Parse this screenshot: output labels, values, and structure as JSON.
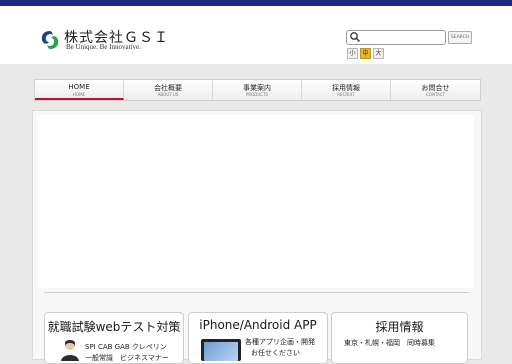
{
  "header": {
    "company_name": "株式会社ＧＳＩ",
    "tagline": "Be Unique. Be Innovative.",
    "search": {
      "placeholder": "",
      "button_label": "SEARCH"
    },
    "font_size": {
      "small": "小",
      "medium": "中",
      "large": "大",
      "selected": "中"
    }
  },
  "nav": [
    {
      "jp": "HOME",
      "en": "HOME"
    },
    {
      "jp": "会社概要",
      "en": "ABOUT US"
    },
    {
      "jp": "事業案内",
      "en": "PRODUCTS"
    },
    {
      "jp": "採用情報",
      "en": "RECRUIT"
    },
    {
      "jp": "お問合せ",
      "en": "CONTACT"
    }
  ],
  "cards": [
    {
      "title": "就職試験webテスト対策",
      "line1": "SPI CAB GAB クレペリン",
      "line2": "一般常識　ビジネスマナー"
    },
    {
      "title": "iPhone/Android APP",
      "line1": "各種アプリ企画・開発",
      "line2": "お任せください"
    },
    {
      "title": "採用情報",
      "line1": "東京・札幌・福岡　同時募集"
    }
  ],
  "colors": {
    "top_bar": "#1c2a86",
    "nav_active_underline": "#c20f2d",
    "font_size_active": "#e0b339"
  }
}
